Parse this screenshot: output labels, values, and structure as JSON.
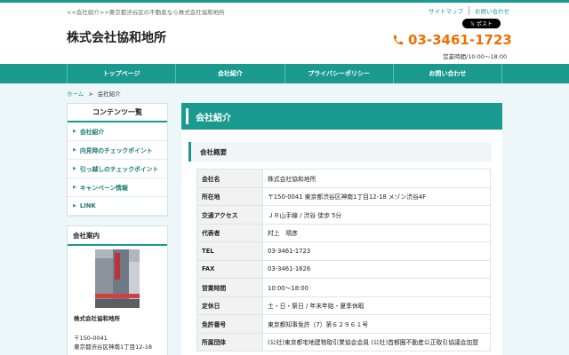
{
  "header": {
    "tagline": "<<会社紹介>>東京都渋谷区の不動産なら株式会社協和地所",
    "links": [
      "サイトマップ",
      "お問い合わせ"
    ],
    "share_label": "𝕏 ポスト",
    "title": "株式会社協和地所",
    "phone": "03-3461-1723",
    "hours": "営業時間/10:00〜18:00"
  },
  "nav": {
    "items": [
      "トップページ",
      "会社紹介",
      "プライバシーポリシー",
      "お問い合わせ"
    ]
  },
  "breadcrumb": {
    "home": "ホーム",
    "separator": ">",
    "current": "会社紹介"
  },
  "sidebar": {
    "contents_title": "コンテンツ一覧",
    "items": [
      "会社紹介",
      "内見時のチェックポイント",
      "引っ越しのチェックポイント",
      "キャンペーン情報",
      "LINK"
    ],
    "info_title": "会社案内",
    "company_name": "株式会社協和地所",
    "postal": "〒150-0041",
    "address": "東京都渋谷区神南1丁目12-18"
  },
  "main": {
    "title": "会社紹介",
    "section_title": "会社概要",
    "table": [
      {
        "key": "会社名",
        "value": "株式会社協和地所"
      },
      {
        "key": "所在地",
        "value": "〒150-0041 東京都渋谷区神南1丁目12-18 メゾン渋谷4F"
      },
      {
        "key": "交通アクセス",
        "value": "ＪＲ山手線 / 渋谷 徒歩 5分"
      },
      {
        "key": "代表者",
        "value": "村上　晴彦"
      },
      {
        "key": "TEL",
        "value": "03-3461-1723"
      },
      {
        "key": "FAX",
        "value": "03-3461-1626"
      },
      {
        "key": "営業時間",
        "value": "10:00〜18:00"
      },
      {
        "key": "定休日",
        "value": "土・日・祭日 / 年末年始・夏季休暇"
      },
      {
        "key": "免許番号",
        "value": "東京都知事免許（7）第６２９６１号"
      },
      {
        "key": "所属団体",
        "value": "(公社)東京都宅地建物取引業協会会員 (公社)首都圏不動産公正取引協議会加盟"
      }
    ]
  },
  "colors": {
    "accent": "#1a9a8f",
    "phone": "#f07000",
    "background": "#edf6f9"
  },
  "icons": {
    "phone": "phone-icon"
  }
}
